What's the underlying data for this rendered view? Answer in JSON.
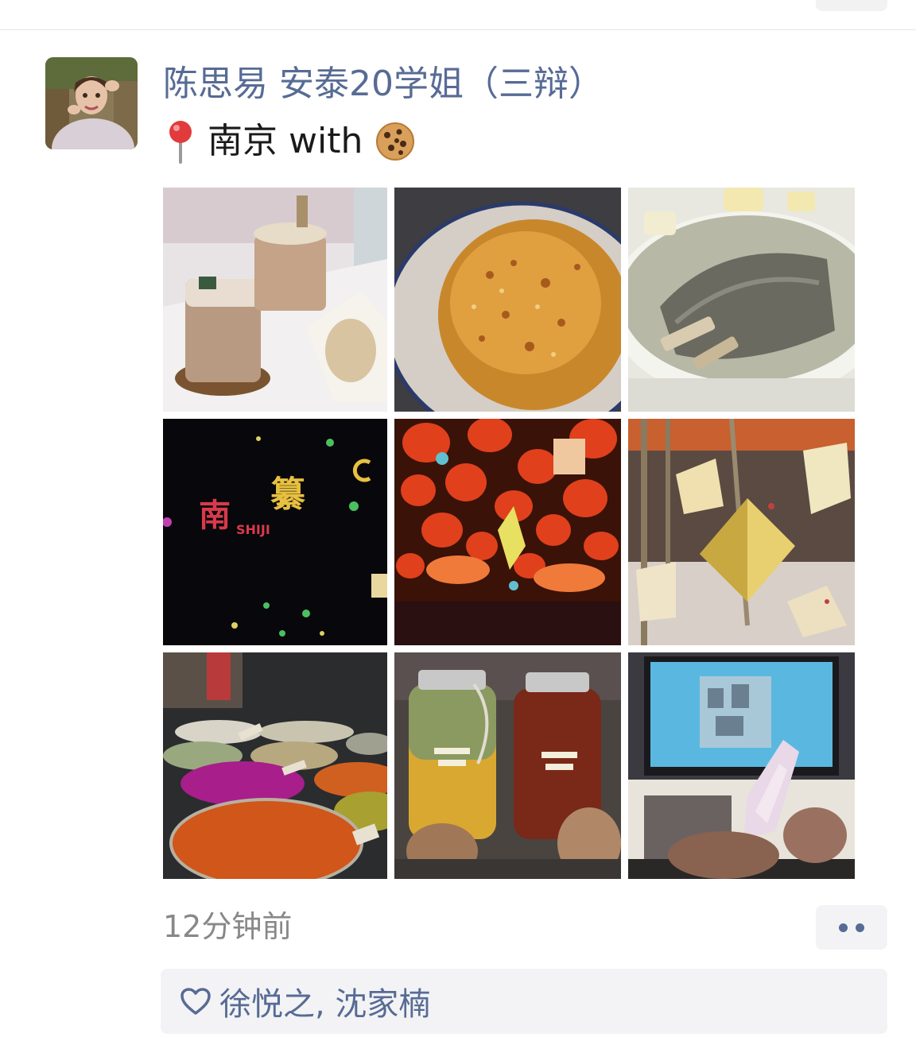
{
  "post": {
    "author_name": "陈思易 安泰20学姐（三辩）",
    "content_text": "南京 with",
    "content_emoji_before": "location-pin",
    "content_emoji_after": "cookie",
    "time_ago": "12分钟前",
    "likes": "徐悦之, 沈家楠"
  },
  "photos": [
    {
      "subject": "iced-coffee-and-scone"
    },
    {
      "subject": "noodles-with-crab-roe"
    },
    {
      "subject": "duck-blood-soup"
    },
    {
      "subject": "neon-sign-at-night"
    },
    {
      "subject": "red-lanterns"
    },
    {
      "subject": "hanging-lanterns"
    },
    {
      "subject": "spice-market-bowls"
    },
    {
      "subject": "bottled-drinks"
    },
    {
      "subject": "tv-and-bottle"
    }
  ],
  "colors": {
    "link_blue": "#576b95",
    "text_dark": "#1a1a1a",
    "time_gray": "#888888",
    "panel_bg": "#f3f3f5"
  }
}
